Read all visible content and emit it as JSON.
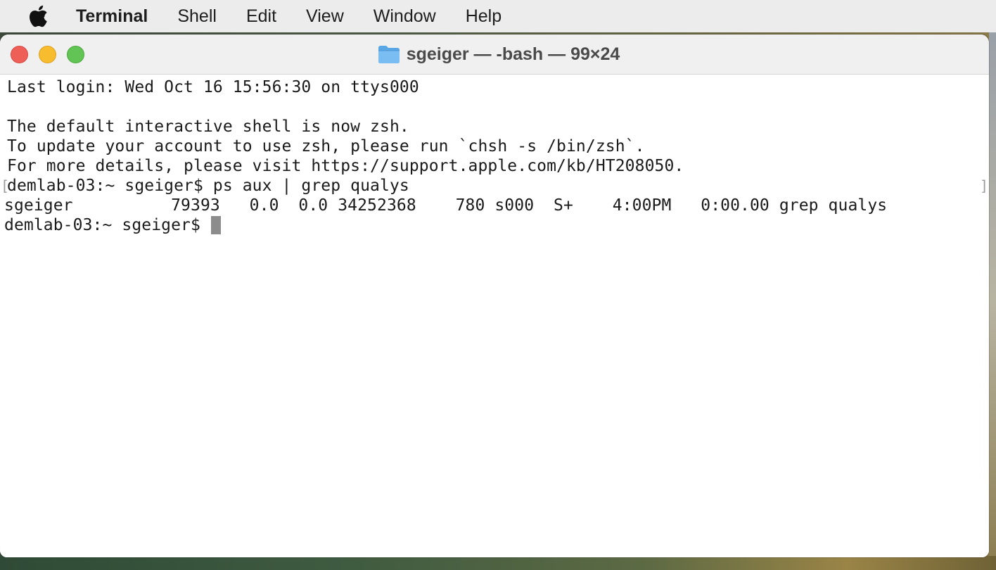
{
  "menubar": {
    "apple_icon": "apple-logo",
    "app_name": "Terminal",
    "items": [
      "Shell",
      "Edit",
      "View",
      "Window",
      "Help"
    ]
  },
  "window": {
    "title": "sgeiger — -bash — 99×24",
    "title_icon": "folder-icon",
    "buttons": {
      "close": "#ee5f58",
      "minimize": "#f8bc2f",
      "zoom": "#61c454"
    }
  },
  "terminal": {
    "lines": [
      "Last login: Wed Oct 16 15:56:30 on ttys000",
      "",
      "The default interactive shell is now zsh.",
      "To update your account to use zsh, please run `chsh -s /bin/zsh`.",
      "For more details, please visit https://support.apple.com/kb/HT208050.",
      "demlab-03:~ sgeiger$ ps aux | grep qualys",
      "sgeiger          79393   0.0  0.0 34252368    780 s000  S+    4:00PM   0:00.00 grep qualys",
      "demlab-03:~ sgeiger$ "
    ],
    "prompt": "demlab-03:~ sgeiger$"
  }
}
